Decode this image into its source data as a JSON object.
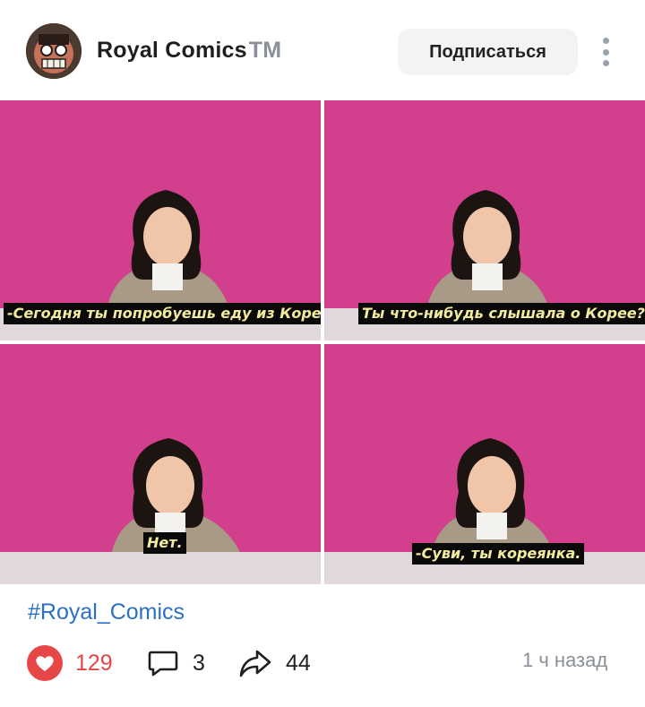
{
  "post": {
    "author": "Royal Comics",
    "author_badge": "TM",
    "subscribe_label": "Подписаться",
    "hashtag": "#Royal_Comics",
    "likes": "129",
    "comments": "3",
    "shares": "44",
    "time": "1 ч назад"
  },
  "panels": [
    {
      "subtitle": "-Сегодня ты попробуешь еду из Кореи."
    },
    {
      "subtitle": "Ты что-нибудь слышала о Корее?"
    },
    {
      "subtitle": "Нет."
    },
    {
      "subtitle": "-Суви, ты кореянка."
    }
  ],
  "colors": {
    "accent_link": "#2a71c5",
    "like_red": "#e64646",
    "backdrop_pink": "#d23f8c",
    "subtitle_text": "#f2ea9c"
  },
  "icons": {
    "more": "more-vertical-icon",
    "like": "heart-icon",
    "comment": "comment-icon",
    "share": "share-arrow-icon"
  }
}
